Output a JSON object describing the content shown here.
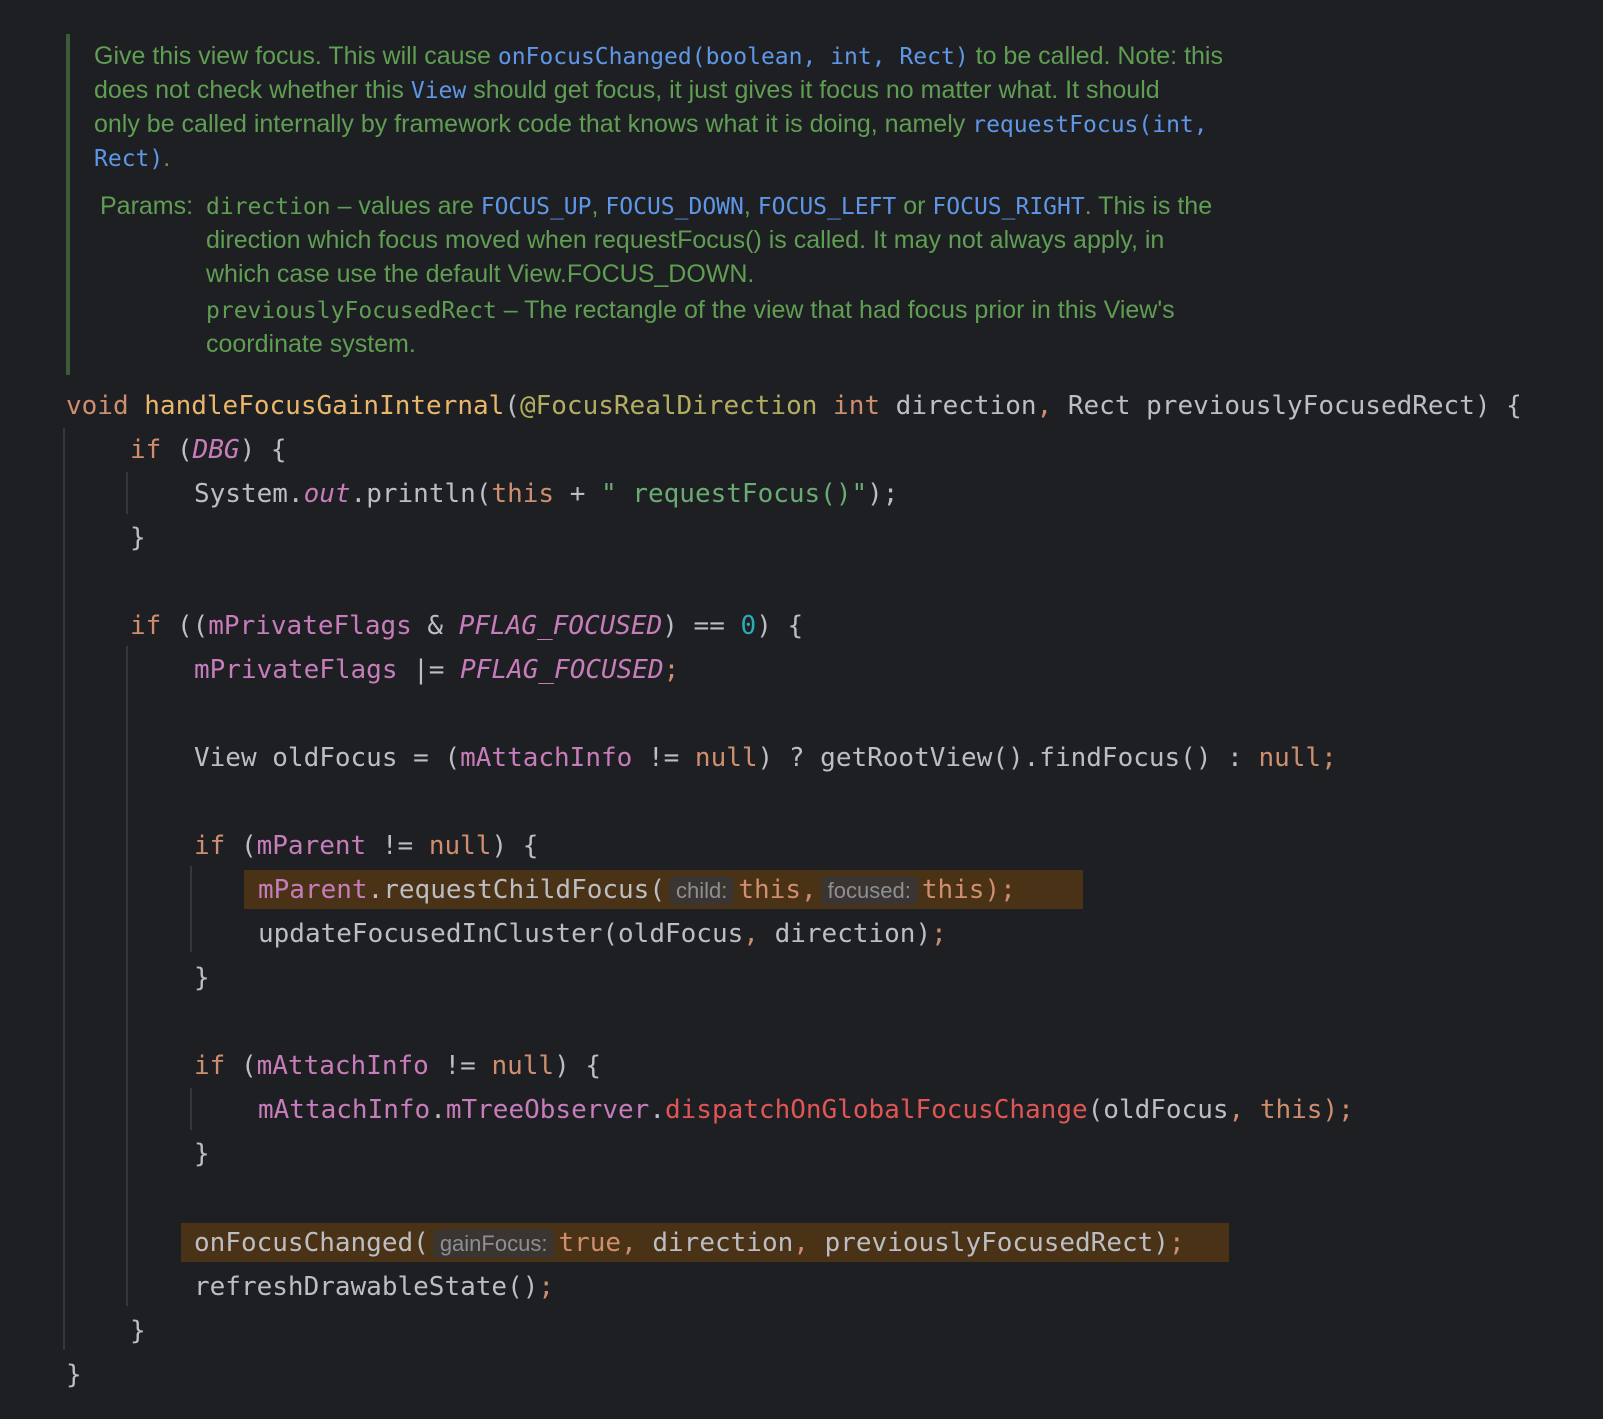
{
  "doc": {
    "l1": [
      "Give this view focus. This will cause ",
      "onFocusChanged(boolean, int, Rect)",
      " to be called. Note: this"
    ],
    "l2": [
      "does not check whether this ",
      "View",
      " should get focus, it just gives it focus no matter what. It should"
    ],
    "l3": [
      "only be called internally by framework code that knows what it is doing, namely ",
      "requestFocus(int,"
    ],
    "l4": [
      "Rect)",
      "."
    ],
    "params_label": "Params:",
    "p1": [
      "direction",
      " – values are ",
      "FOCUS_UP",
      ", ",
      "FOCUS_DOWN",
      ", ",
      "FOCUS_LEFT",
      " or ",
      "FOCUS_RIGHT",
      ". This is the"
    ],
    "p2": "direction which focus moved when requestFocus() is called. It may not always apply, in",
    "p3": "which case use the default View.FOCUS_DOWN.",
    "p4": [
      "previouslyFocusedRect",
      " – The rectangle of the view that had focus prior in this View's"
    ],
    "p5": "coordinate system."
  },
  "code": {
    "c1": [
      "void",
      " ",
      "handleFocusGainInternal",
      "(",
      "@FocusRealDirection",
      " ",
      "int",
      " direction",
      ",",
      " Rect previouslyFocusedRect) {"
    ],
    "c2": [
      "if",
      " (",
      "DBG",
      ") {"
    ],
    "c3": [
      "System.",
      "out",
      ".println(",
      "this",
      " + ",
      "\" requestFocus()\"",
      ");"
    ],
    "c4": "}",
    "c5": [
      "if",
      " ((",
      "mPrivateFlags",
      " & ",
      "PFLAG_FOCUSED",
      ") == ",
      "0",
      ") {"
    ],
    "c6": [
      "mPrivateFlags",
      " |= ",
      "PFLAG_FOCUSED",
      ";"
    ],
    "c7": [
      "View oldFocus = (",
      "mAttachInfo",
      " != ",
      "null",
      ") ? getRootView().findFocus() : ",
      "null",
      ";"
    ],
    "c8": [
      "if",
      " (",
      "mParent",
      " != ",
      "null",
      ") {"
    ],
    "c9": [
      "mParent",
      ".requestChildFocus(",
      "child:",
      "this",
      ",",
      "focused:",
      "this",
      ");"
    ],
    "c10": [
      "updateFocusedInCluster(oldFocus",
      ",",
      " direction)",
      ";"
    ],
    "c11": "}",
    "c12": [
      "if",
      " (",
      "mAttachInfo",
      " != ",
      "null",
      ") {"
    ],
    "c13": [
      "mAttachInfo",
      ".",
      "mTreeObserver",
      ".",
      "dispatchOnGlobalFocusChange",
      "(oldFocus",
      ",",
      " ",
      "this",
      ");"
    ],
    "c14": "}",
    "c15": [
      "onFocusChanged(",
      "gainFocus:",
      "true",
      ",",
      " direction",
      ",",
      " previouslyFocusedRect)",
      ";"
    ],
    "c16": [
      "refreshDrawableState()",
      ";"
    ],
    "c17": "}",
    "c18": "}"
  },
  "colors": {
    "background": "#1e1f22",
    "comment": "#5f9e53",
    "keyword": "#cf8e6d",
    "field": "#c77dbb",
    "highlight": "#4a3216"
  }
}
